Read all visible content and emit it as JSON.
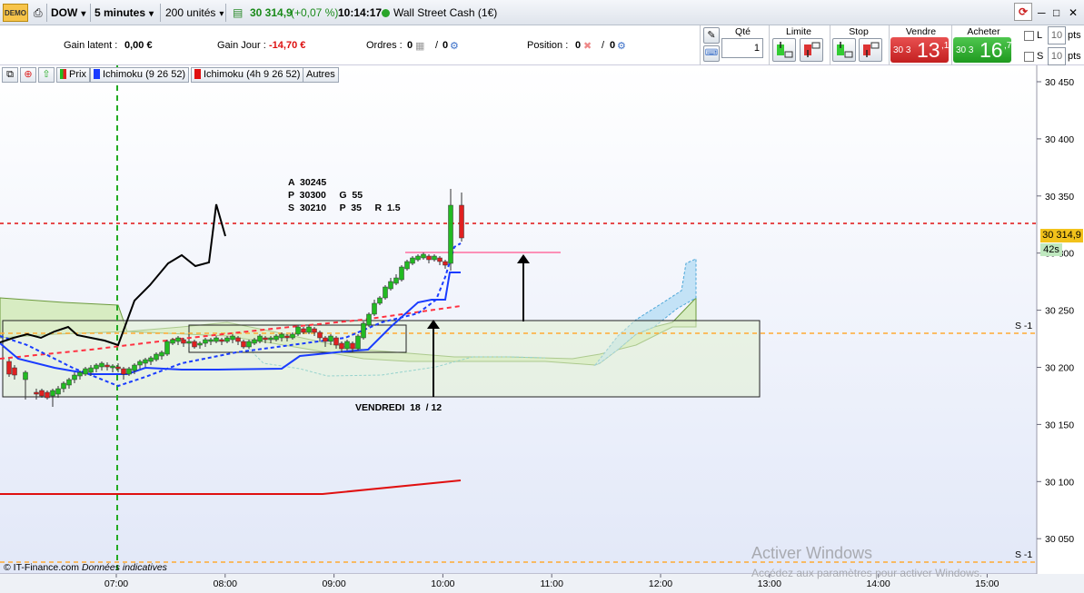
{
  "toolbar": {
    "demo_label": "DEMO",
    "instrument": "DOW",
    "timeframe": "5 minutes",
    "units": "200 unités",
    "quote": "30 314,9",
    "change": "(+0,07 %)",
    "time": "10:14:17",
    "market_name": "Wall Street Cash (1€)"
  },
  "info": {
    "latent_label": "Gain latent :",
    "latent_value": "0,00 €",
    "day_label": "Gain Jour :",
    "day_value": "-14,70 €",
    "orders_label": "Ordres :",
    "orders_a": "0",
    "orders_sep": "/",
    "orders_b": "0",
    "position_label": "Position :",
    "position_a": "0",
    "position_sep": "/",
    "position_b": "0"
  },
  "order_panel": {
    "qty_label": "Qté",
    "qty_value": "1",
    "limit_label": "Limite",
    "stop_label": "Stop",
    "sell_label": "Vendre",
    "sell_prefix": "30 3",
    "sell_big": "13",
    "sell_sup": ",1",
    "buy_label": "Acheter",
    "buy_prefix": "30 3",
    "buy_big": "16",
    "buy_sup": ",7",
    "l_label": "L",
    "l_value": "10",
    "l_unit": "pts",
    "s_label": "S",
    "s_value": "10",
    "s_unit": "pts"
  },
  "chart_tabs": {
    "prix": "Prix",
    "ichimoku1": "Ichimoku (9 26 52)",
    "ichimoku2": "Ichimoku (4h 9 26 52)",
    "autres": "Autres"
  },
  "colors": {
    "bull": "#22bb22",
    "bear": "#e02020",
    "tenkan": "#1a3cff",
    "kijun_4h": "#e01010",
    "support": "#ffaa33",
    "cloud_green": "#d6ecc4",
    "cloud_blue": "#c6e4f6"
  },
  "chart_data": {
    "type": "candlestick",
    "y_ticks": [
      "30 450",
      "30 400",
      "30 350",
      "30 300",
      "30 250",
      "30 200",
      "30 150",
      "30 100",
      "30 050"
    ],
    "x_ticks": [
      "07:00",
      "08:00",
      "09:00",
      "10:00",
      "11:00",
      "12:00",
      "13:00",
      "14:00",
      "15:00"
    ],
    "ylim": [
      30020,
      30460
    ],
    "current_price_label": "30 314,9",
    "countdown_label": "42s",
    "support_label_1": "S -1",
    "support_label_2": "S -1",
    "support_levels": [
      30230,
      30030
    ],
    "resistance_level": 30325,
    "annotation": {
      "line1": "A  30245",
      "line2": "P  30300     G  55",
      "line3": "S  30210     P  35     R  1.5"
    },
    "date_label": "VENDREDI  18  / 12",
    "source_label": "© IT-Finance.com",
    "source_note": "Données indicatives"
  },
  "watermark": {
    "title": "Activer Windows",
    "subtitle": "Accédez aux paramètres pour activer Windows."
  }
}
